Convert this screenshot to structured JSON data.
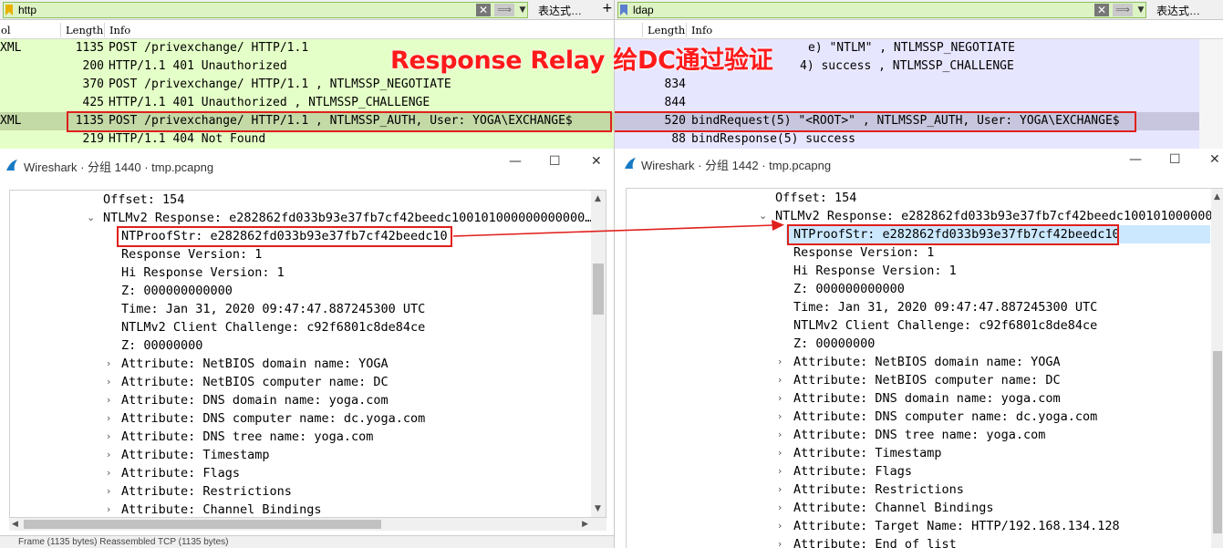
{
  "left": {
    "filter": {
      "value": "http",
      "expr_label": "表达式…",
      "plus": "+"
    },
    "columns": {
      "protocol": "ol",
      "length": "Length",
      "info": "Info"
    },
    "packets": [
      {
        "protocol": "XML",
        "length": "1135",
        "info": "POST /privexchange/ HTTP/1.1"
      },
      {
        "protocol": "",
        "length": "200",
        "info": "HTTP/1.1 401 Unauthorized"
      },
      {
        "protocol": "",
        "length": "370",
        "info": "POST /privexchange/ HTTP/1.1 , NTLMSSP_NEGOTIATE"
      },
      {
        "protocol": "",
        "length": "425",
        "info": "HTTP/1.1 401 Unauthorized , NTLMSSP_CHALLENGE"
      },
      {
        "protocol": "XML",
        "length": "1135",
        "info": "POST /privexchange/ HTTP/1.1 , NTLMSSP_AUTH, User: YOGA\\EXCHANGE$"
      },
      {
        "protocol": "",
        "length": "219",
        "info": "HTTP/1.1 404 Not Found"
      }
    ],
    "window_title": "Wireshark · 分组 1440 · tmp.pcapng",
    "tree": [
      "Offset: 154",
      "NTLMv2 Response: e282862fd033b93e37fb7cf42beedc100101000000000000…",
      "NTProofStr: e282862fd033b93e37fb7cf42beedc10",
      "Response Version: 1",
      "Hi Response Version: 1",
      "Z: 000000000000",
      "Time: Jan 31, 2020 09:47:47.887245300 UTC",
      "NTLMv2 Client Challenge: c92f6801c8de84ce",
      "Z: 00000000",
      "Attribute: NetBIOS domain name: YOGA",
      "Attribute: NetBIOS computer name: DC",
      "Attribute: DNS domain name: yoga.com",
      "Attribute: DNS computer name: dc.yoga.com",
      "Attribute: DNS tree name: yoga.com",
      "Attribute: Timestamp",
      "Attribute: Flags",
      "Attribute: Restrictions",
      "Attribute: Channel Bindings"
    ],
    "status_text": "Frame (1135 bytes)    Reassembled TCP (1135 bytes)"
  },
  "right": {
    "filter": {
      "value": "ldap",
      "expr_label": "表达式…"
    },
    "columns": {
      "length": "Length",
      "info": "Info"
    },
    "packets": [
      {
        "length": "",
        "info": "e) \"NTLM\" , NTLMSSP_NEGOTIATE"
      },
      {
        "length": "",
        "info": "4) success , NTLMSSP_CHALLENGE"
      },
      {
        "length": "834",
        "info": ""
      },
      {
        "length": "844",
        "info": ""
      },
      {
        "length": "520",
        "info": "bindRequest(5) \"<ROOT>\" , NTLMSSP_AUTH, User: YOGA\\EXCHANGE$"
      },
      {
        "length": "88",
        "info": "bindResponse(5) success"
      }
    ],
    "window_title": "Wireshark · 分组 1442 · tmp.pcapng",
    "tree": [
      "Offset: 154",
      "NTLMv2 Response: e282862fd033b93e37fb7cf42beedc100101000000000",
      "NTProofStr: e282862fd033b93e37fb7cf42beedc10",
      "Response Version: 1",
      "Hi Response Version: 1",
      "Z: 000000000000",
      "Time: Jan 31, 2020 09:47:47.887245300 UTC",
      "NTLMv2 Client Challenge: c92f6801c8de84ce",
      "Z: 00000000",
      "Attribute: NetBIOS domain name: YOGA",
      "Attribute: NetBIOS computer name: DC",
      "Attribute: DNS domain name: yoga.com",
      "Attribute: DNS computer name: dc.yoga.com",
      "Attribute: DNS tree name: yoga.com",
      "Attribute: Timestamp",
      "Attribute: Flags",
      "Attribute: Restrictions",
      "Attribute: Channel Bindings",
      "Attribute: Target Name: HTTP/192.168.134.128",
      "Attribute: End of list"
    ]
  },
  "annotation": {
    "text": "Response Relay 给DC通过验证",
    "color": "#ff1a1a"
  },
  "colors": {
    "http_row": "#e4ffc7",
    "ldap_row": "#e7e6ff",
    "selected_http": "#c3d9a6",
    "selected_ldap": "#c8c6de",
    "red_box": "#e0201c",
    "arrow": "#e0201c",
    "highlight": "#cce8ff"
  },
  "icons": {
    "filter_bookmark": "bookmark-icon",
    "clear": "clear-icon",
    "apply": "apply-arrow-icon",
    "window": "wireshark-fin-icon",
    "expand": "chevron-right-icon",
    "collapse": "chevron-down-icon"
  }
}
